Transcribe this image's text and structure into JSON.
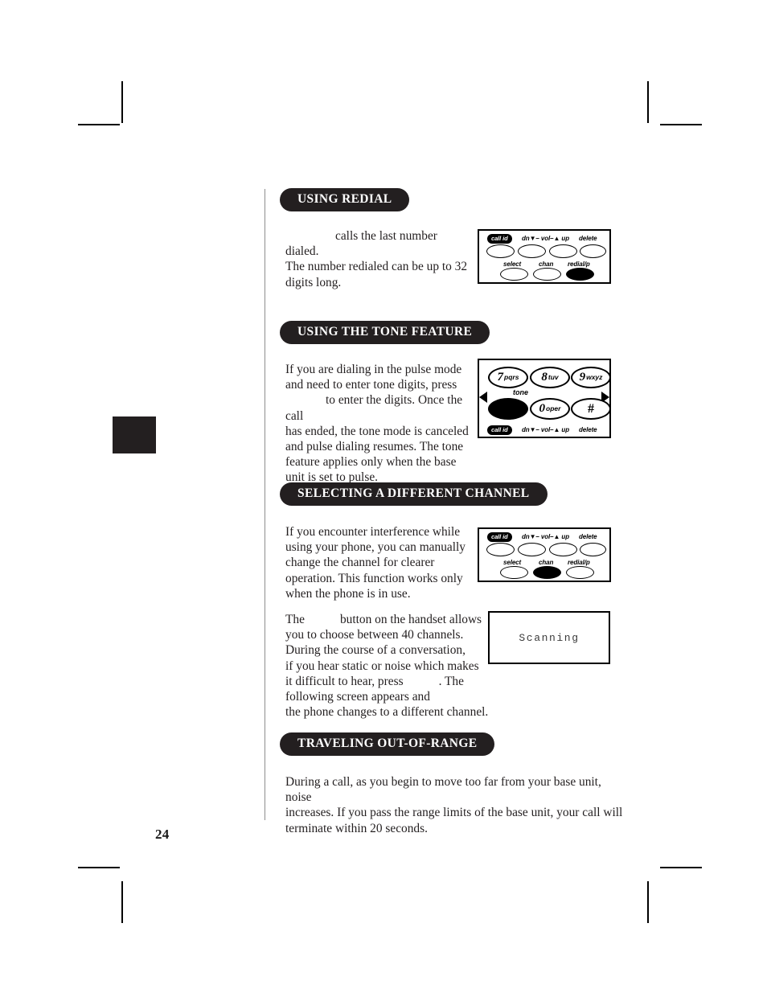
{
  "page": {
    "number": "24"
  },
  "sections": [
    {
      "id": "using-redial",
      "heading": "USING REDIAL",
      "paragraphs": [
        "calls the last number dialed. The number redialed can be up to 32 digits long."
      ],
      "body_lines": [
        "calls the last number dialed.",
        "The number redialed can be up to 32",
        "digits long."
      ]
    },
    {
      "id": "using-the-tone-feature",
      "heading": "USING THE TONE FEATURE",
      "body_lines": [
        "If you are dialing in the pulse mode",
        "and need to enter tone digits, press",
        "to enter the digits. Once the call",
        "has ended, the tone mode is canceled",
        "and pulse dialing resumes. The tone",
        "feature applies only when the base",
        "unit is set to pulse."
      ]
    },
    {
      "id": "selecting-a-different-channel",
      "heading": "SELECTING A DIFFERENT CHANNEL",
      "body_lines": [
        "If you encounter interference while",
        "using your phone, you can manually",
        "change the channel for clearer",
        "operation. This function works only",
        "when the phone is in use."
      ],
      "body_lines_2": [
        "The",
        "button on the handset allows",
        "you to choose between 40 channels.",
        "During the course of a conversation,",
        "if you hear static or noise which makes",
        "it difficult to hear, press",
        ". The",
        "following screen appears and",
        "the phone changes to a different channel."
      ]
    },
    {
      "id": "traveling-out-of-range",
      "heading": "TRAVELING OUT-OF-RANGE",
      "body_lines": [
        "During a call, as you begin to move too far from your base unit, noise",
        "increases. If you pass the range limits of the base unit, your call will",
        "terminate within 20 seconds."
      ]
    }
  ],
  "figures": {
    "redial_panel": {
      "row1_labels": [
        "call id",
        "dn▼– vol–▲ up",
        "delete"
      ],
      "row2_labels": [
        "select",
        "chan",
        "redial/p"
      ],
      "highlighted_key": "redial/p"
    },
    "channel_panel": {
      "row1_labels": [
        "call id",
        "dn▼– vol–▲ up",
        "delete"
      ],
      "row2_labels": [
        "select",
        "chan",
        "redial/p"
      ],
      "highlighted_key": "chan"
    },
    "tone_keypad": {
      "keys": [
        {
          "digit": "7",
          "letters": "pqrs"
        },
        {
          "digit": "8",
          "letters": " tuv"
        },
        {
          "digit": "9",
          "letters": "wxyz"
        },
        {
          "digit": "",
          "letters": ""
        },
        {
          "digit": "0",
          "letters": "oper"
        },
        {
          "digit": "#",
          "letters": ""
        }
      ],
      "tone_label": "tone",
      "bottom_labels": [
        "call id",
        "dn▼– vol–▲ up",
        "delete"
      ],
      "highlighted_key": "tone",
      "left_arrow": "◀",
      "right_arrow": "▶"
    },
    "lcd_screen": {
      "text": "Scanning"
    }
  },
  "colors": {
    "ink": "#231f20",
    "paper": "#ffffff",
    "rule": "#8d8d8d",
    "lcd_text": "#3a3a3a"
  }
}
